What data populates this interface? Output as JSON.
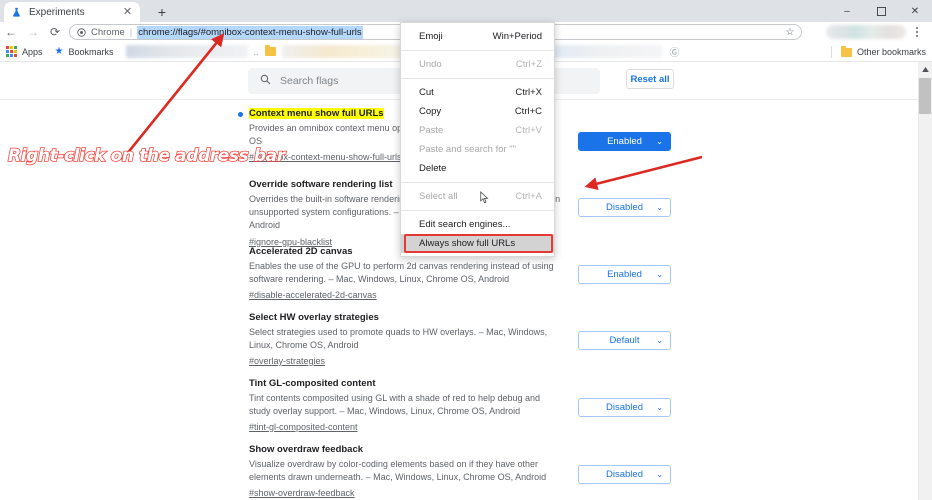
{
  "window": {
    "minimize_label": "–",
    "maximize_label": "❐",
    "close_label": "✕"
  },
  "tabstrip": {
    "tab_title": "Experiments",
    "tab_close_label": "✕",
    "new_tab_label": "+"
  },
  "toolbar": {
    "back_label": "←",
    "forward_label": "→",
    "reload_label": "⟳",
    "scheme_label": "Chrome",
    "separator": "|",
    "url": "chrome://flags/#omnibox-context-menu-show-full-urls",
    "star_label": "☆"
  },
  "bookmarks": {
    "apps_label": "Apps",
    "bookmarks_label": "Bookmarks",
    "ellipsis": "..",
    "globe_label": "Ⓖ",
    "other_bookmarks_label": "Other bookmarks"
  },
  "flags_page": {
    "search_placeholder": "Search flags",
    "reset_all_label": "Reset all",
    "entries": [
      {
        "title": "Context menu show full URLs",
        "highlighted": true,
        "description": "Provides an omnibox context menu option – Mac, Windows, Linux, Chrome OS",
        "permalink": "#omnibox-context-menu-show-full-urls",
        "state": "Enabled",
        "state_filled": true
      },
      {
        "title": "Override software rendering list",
        "highlighted": false,
        "description": "Overrides the built-in software rendering list and enables GPU-acceleration on unsupported system configurations. – Mac, Windows, Linux, Chrome OS, Android",
        "permalink": "#ignore-gpu-blacklist",
        "state": "Disabled",
        "state_filled": false
      },
      {
        "title": "Accelerated 2D canvas",
        "highlighted": false,
        "description": "Enables the use of the GPU to perform 2d canvas rendering instead of using software rendering. – Mac, Windows, Linux, Chrome OS, Android",
        "permalink": "#disable-accelerated-2d-canvas",
        "state": "Enabled",
        "state_filled": false
      },
      {
        "title": "Select HW overlay strategies",
        "highlighted": false,
        "description": "Select strategies used to promote quads to HW overlays. – Mac, Windows, Linux, Chrome OS, Android",
        "permalink": "#overlay-strategies",
        "state": "Default",
        "state_filled": false
      },
      {
        "title": "Tint GL-composited content",
        "highlighted": false,
        "description": "Tint contents composited using GL with a shade of red to help debug and study overlay support. – Mac, Windows, Linux, Chrome OS, Android",
        "permalink": "#tint-gl-composited-content",
        "state": "Disabled",
        "state_filled": false
      },
      {
        "title": "Show overdraw feedback",
        "highlighted": false,
        "description": "Visualize overdraw by color-coding elements based on if they have other elements drawn underneath. – Mac, Windows, Linux, Chrome OS, Android",
        "permalink": "#show-overdraw-feedback",
        "state": "Disabled",
        "state_filled": false
      }
    ],
    "caret_glyph": "⌄"
  },
  "context_menu": {
    "items": [
      {
        "label": "Emoji",
        "accel": "Win+Period",
        "disabled": false,
        "separator_after": true
      },
      {
        "label": "Undo",
        "accel": "Ctrl+Z",
        "disabled": true,
        "separator_after": true
      },
      {
        "label": "Cut",
        "accel": "Ctrl+X",
        "disabled": false,
        "separator_after": false
      },
      {
        "label": "Copy",
        "accel": "Ctrl+C",
        "disabled": false,
        "separator_after": false
      },
      {
        "label": "Paste",
        "accel": "Ctrl+V",
        "disabled": true,
        "separator_after": false
      },
      {
        "label": "Paste and search for \"\"",
        "accel": "",
        "disabled": true,
        "separator_after": false
      },
      {
        "label": "Delete",
        "accel": "",
        "disabled": false,
        "separator_after": true
      },
      {
        "label": "Select all",
        "accel": "Ctrl+A",
        "disabled": true,
        "separator_after": true
      },
      {
        "label": "Edit search engines...",
        "accel": "",
        "disabled": false,
        "separator_after": false
      },
      {
        "label": "Always show full URLs",
        "accel": "",
        "disabled": false,
        "separator_after": false,
        "hovered": true,
        "boxed": true
      }
    ]
  },
  "annotations": {
    "instruction": "Right-click on the address bar"
  },
  "colors": {
    "accent_blue": "#1a73e8",
    "annotation_red": "#f4473f",
    "highlight_yellow": "#ffff00",
    "url_selection": "#b3d7fd"
  },
  "scrollbar": {
    "up_arrow": "▲"
  }
}
